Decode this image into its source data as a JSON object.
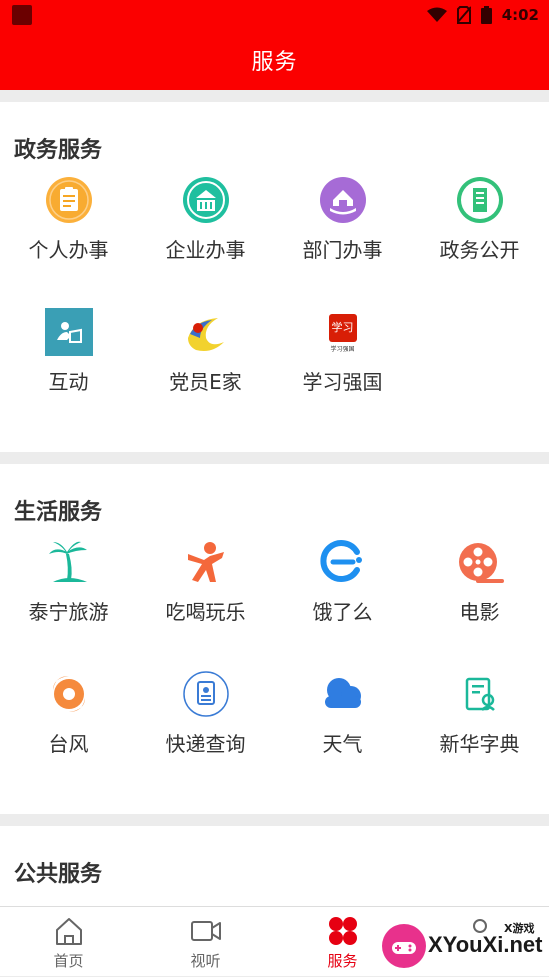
{
  "status": {
    "time": "4:02"
  },
  "header": {
    "title": "服务"
  },
  "sections": [
    {
      "title": "政务服务",
      "items": [
        {
          "label": "个人办事",
          "icon": "clipboard-icon"
        },
        {
          "label": "企业办事",
          "icon": "building-icon"
        },
        {
          "label": "部门办事",
          "icon": "house-hand-icon"
        },
        {
          "label": "政务公开",
          "icon": "document-icon"
        },
        {
          "label": "互动",
          "icon": "interaction-icon"
        },
        {
          "label": "党员E家",
          "icon": "party-icon"
        },
        {
          "label": "学习强国",
          "icon": "xuexi-icon"
        }
      ]
    },
    {
      "title": "生活服务",
      "items": [
        {
          "label": "泰宁旅游",
          "icon": "palm-tree-icon"
        },
        {
          "label": "吃喝玩乐",
          "icon": "person-jump-icon"
        },
        {
          "label": "饿了么",
          "icon": "eleme-icon"
        },
        {
          "label": "电影",
          "icon": "film-reel-icon"
        },
        {
          "label": "台风",
          "icon": "typhoon-icon"
        },
        {
          "label": "快递查询",
          "icon": "express-icon"
        },
        {
          "label": "天气",
          "icon": "cloud-icon"
        },
        {
          "label": "新华字典",
          "icon": "dictionary-icon"
        }
      ]
    },
    {
      "title": "公共服务",
      "items": []
    }
  ],
  "tabs": [
    {
      "label": "首页",
      "icon": "home-icon"
    },
    {
      "label": "视听",
      "icon": "video-icon"
    },
    {
      "label": "服务",
      "icon": "service-icon",
      "active": true
    },
    {
      "label": "",
      "icon": "user-icon"
    }
  ],
  "xuexi_badge": {
    "mark": "学习",
    "caption": "学习强国"
  },
  "watermark": {
    "text": "XYouXi.net",
    "small": "X游戏"
  },
  "colors": {
    "brand": "#fb0000",
    "active_tab": "#e60012"
  }
}
